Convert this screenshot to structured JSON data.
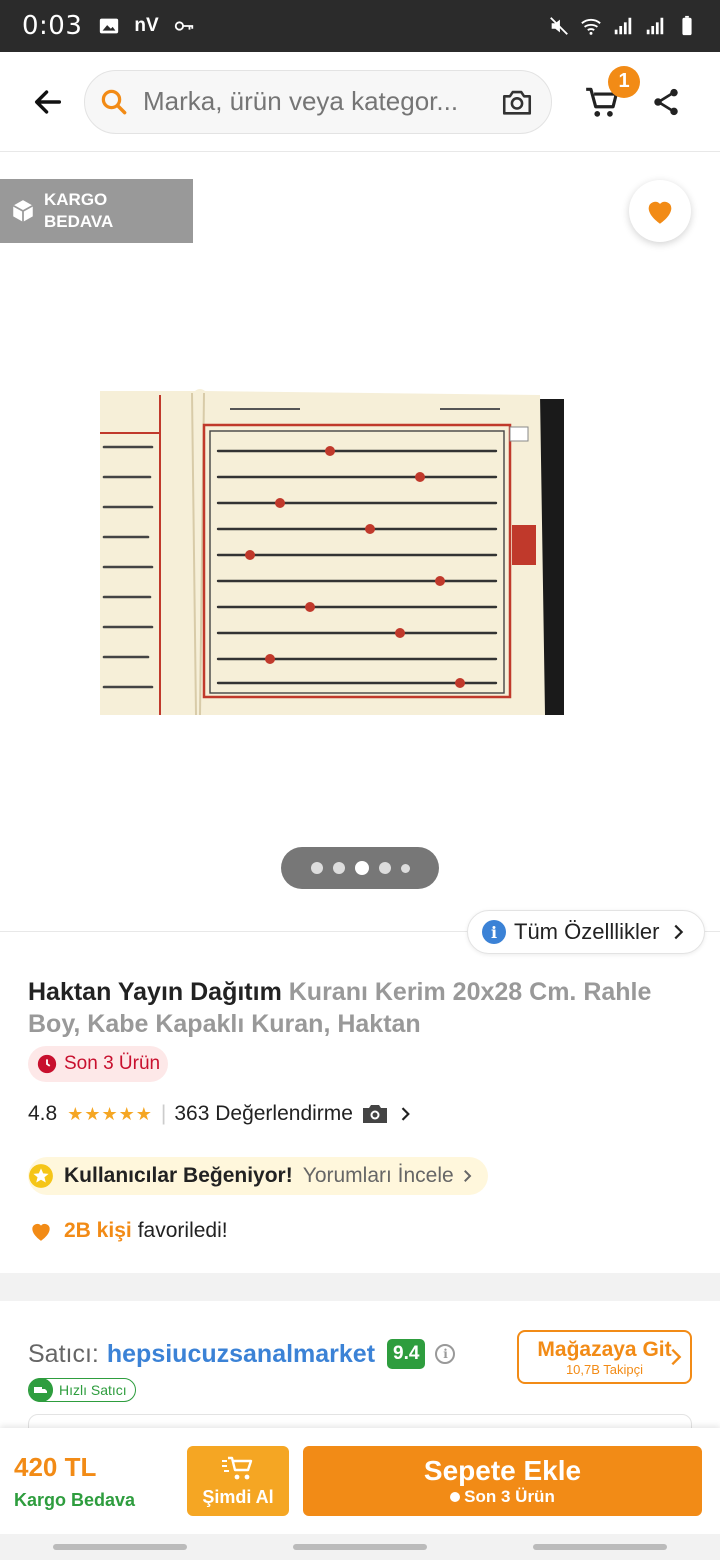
{
  "status": {
    "time": "0:03",
    "left_icons": [
      "image-icon",
      "nv-icon",
      "key-icon"
    ],
    "right_icons": [
      "mute-icon",
      "wifi-icon",
      "signal-icon",
      "signal-icon",
      "battery-icon"
    ]
  },
  "header": {
    "search_placeholder": "Marka, ürün veya kategor...",
    "cart_count": "1"
  },
  "gallery": {
    "badge_line1": "KARGO",
    "badge_line2": "BEDAVA",
    "page_count": 5,
    "active_page": 3
  },
  "product": {
    "specs_label": "Tüm Özelllikler",
    "brand": "Haktan Yayın Dağıtım",
    "name": "Kuranı Kerim 20x28 Cm. Rahle Boy, Kabe Kapaklı Kuran, Haktan",
    "stock": "Son 3 Ürün",
    "rating": "4.8",
    "rating_stars": 5,
    "reviews": "363 Değerlendirme",
    "likes_title": "Kullanıcılar Beğeniyor!",
    "likes_link": "Yorumları İncele",
    "fav_count": "2B kişi",
    "fav_text": "favoriledi!"
  },
  "seller": {
    "label": "Satıcı:",
    "name": "hepsiucuzsanalmarket",
    "score": "9.4",
    "fast_badge": "Hızlı Satıcı",
    "store_button": "Mağazaya Git",
    "followers": "10,7B Takipçi"
  },
  "bottom": {
    "price": "420 TL",
    "shipping": "Kargo Bedava",
    "buy_now": "Şimdi Al",
    "add_to_cart": "Sepete Ekle",
    "add_sub": "Son 3 Ürün"
  },
  "colors": {
    "accent": "#f28b16",
    "link": "#3b82d6",
    "green": "#2e9d3e",
    "stock_red": "#c8102e"
  }
}
